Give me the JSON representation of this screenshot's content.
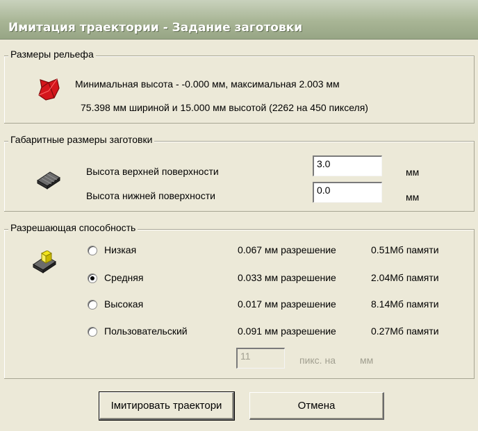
{
  "window": {
    "title": "Имитация траектории - Задание заготовки"
  },
  "relief": {
    "legend": "Размеры рельефа",
    "icon": "relief-icon",
    "line1": "Минимальная высота - -0.000 мм, максимальная 2.003 мм",
    "line2": "75.398 мм шириной и 15.000 мм высотой (2262 на 450 пикселя)"
  },
  "blank": {
    "legend": "Габаритные размеры заготовки",
    "icon": "blank-block-icon",
    "top_label": "Высота верхней поверхности",
    "top_value": "3.0",
    "bottom_label": "Высота нижней поверхности",
    "bottom_value": "0.0",
    "unit": "мм"
  },
  "resolution": {
    "legend": "Разрешающая способность",
    "icon": "resolution-icon",
    "options": [
      {
        "label": "Низкая",
        "res": "0.067 мм разрешение",
        "mem": "0.51Мб памяти",
        "checked": false
      },
      {
        "label": "Средняя",
        "res": "0.033 мм разрешение",
        "mem": "2.04Мб памяти",
        "checked": true
      },
      {
        "label": "Высокая",
        "res": "0.017 мм разрешение",
        "mem": "8.14Мб памяти",
        "checked": false
      },
      {
        "label": "Пользовательский",
        "res": "0.091 мм разрешение",
        "mem": "0.27Мб памяти",
        "checked": false
      }
    ],
    "custom_value": "11",
    "custom_unit_a": "пикс. на",
    "custom_unit_b": "мм"
  },
  "buttons": {
    "simulate": "Імитировать траектори",
    "cancel": "Отмена"
  }
}
